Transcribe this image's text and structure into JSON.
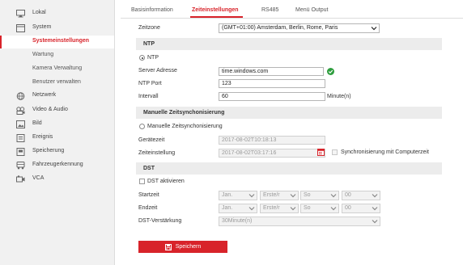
{
  "sidebar": {
    "items": [
      {
        "label": "Lokal",
        "icon": "monitor-icon"
      },
      {
        "label": "System",
        "icon": "system-icon"
      },
      {
        "label": "Systemeinstellungen",
        "sub": true,
        "active": true
      },
      {
        "label": "Wartung",
        "sub": true
      },
      {
        "label": "Kamera Verwaltung",
        "sub": true
      },
      {
        "label": "Benutzer verwalten",
        "sub": true
      },
      {
        "label": "Netzwerk",
        "icon": "globe-icon"
      },
      {
        "label": "Video & Audio",
        "icon": "video-audio-icon"
      },
      {
        "label": "Bild",
        "icon": "image-icon"
      },
      {
        "label": "Ereignis",
        "icon": "event-icon"
      },
      {
        "label": "Speicherung",
        "icon": "storage-icon"
      },
      {
        "label": "Fahrzeugerkennung",
        "icon": "vehicle-icon"
      },
      {
        "label": "VCA",
        "icon": "vca-icon"
      }
    ]
  },
  "tabs": [
    {
      "label": "Basisinformation"
    },
    {
      "label": "Zeiteinstellungen",
      "active": true
    },
    {
      "label": "RS485"
    },
    {
      "label": "Menü Output"
    }
  ],
  "form": {
    "timezone": {
      "label": "Zeitzone",
      "value": "(GMT+01:00) Amsterdam, Berlin, Rome, Paris"
    },
    "ntp": {
      "section": "NTP",
      "radio_label": "NTP",
      "server_label": "Server Adresse",
      "server_value": "time.windows.com",
      "port_label": "NTP Port",
      "port_value": "123",
      "interval_label": "Intervall",
      "interval_value": "60",
      "interval_unit": "Minute(n)"
    },
    "manual": {
      "section": "Manuelle Zeitsynchonisierung",
      "radio_label": "Manuelle Zeitsynchonisierung",
      "device_time_label": "Gerätezeit",
      "device_time_value": "2017-08-02T10:18:13",
      "time_setting_label": "Zeiteinstellung",
      "time_setting_value": "2017-08-02T03:17:16",
      "sync_label": "Synchronisierung mit Computerzeit"
    },
    "dst": {
      "section": "DST",
      "enable_label": "DST aktivieren",
      "start_label": "Startzeit",
      "end_label": "Endzeit",
      "start": {
        "month": "Jan.",
        "week": "Erste/r",
        "day": "So",
        "hour": "00"
      },
      "end": {
        "month": "Jan.",
        "week": "Erste/r",
        "day": "So",
        "hour": "00"
      },
      "bias_label": "DST-Verstärkung",
      "bias_value": "30Minute(n)"
    },
    "save_label": "Speichern"
  },
  "colors": {
    "accent": "#d8232a",
    "ok": "#2e9e3e"
  }
}
